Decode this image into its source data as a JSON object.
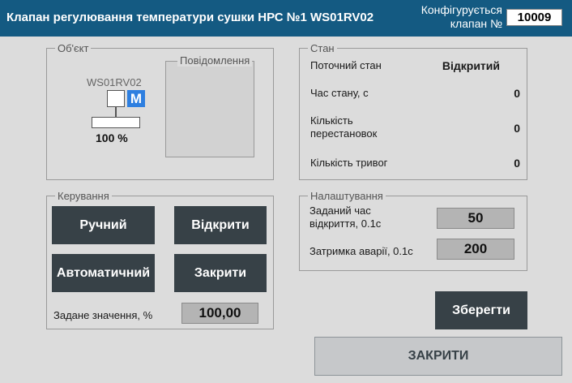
{
  "header": {
    "title": "Клапан регулювання температури сушки НРС №1 WS01RV02",
    "configured_label_line1": "Конфігурується",
    "configured_label_line2": "клапан №",
    "configured_value": "10009"
  },
  "object": {
    "legend": "Об'єкт",
    "valve_tag": "WS01RV02",
    "mode_badge": "M",
    "position_percent": "100 %",
    "messages_title": "Повідомлення"
  },
  "state": {
    "legend": "Стан",
    "rows": [
      {
        "label": "Поточний стан",
        "value": "Відкритий"
      },
      {
        "label": "Час стану, с",
        "value": "0"
      },
      {
        "label": "Кількість перестановок",
        "value": "0"
      },
      {
        "label": "Кількість тривог",
        "value": "0"
      }
    ]
  },
  "control": {
    "legend": "Керування",
    "manual_label": "Ручний",
    "open_label": "Відкрити",
    "auto_label": "Автоматичний",
    "close_label": "Закрити",
    "setpoint_label": "Задане значення, %",
    "setpoint_value": "100,00"
  },
  "settings": {
    "legend": "Налаштування",
    "open_time_label": "Заданий час відкриття, 0.1с",
    "open_time_value": "50",
    "alarm_delay_label": "Затримка аварії, 0.1с",
    "alarm_delay_value": "200"
  },
  "save_label": "Зберегти",
  "close_window_label": "ЗАКРИТИ",
  "colors": {
    "header_bg": "#145a82",
    "button_bg": "#374147",
    "mode_badge": "#2e7fe0",
    "background": "#dcdcdc"
  }
}
